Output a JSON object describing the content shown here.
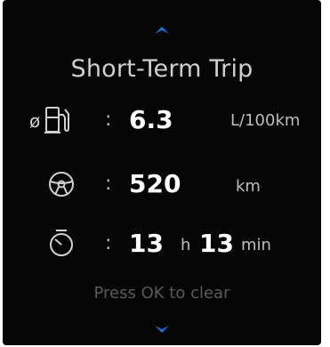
{
  "nav": {
    "up_icon": "chevron-up-icon",
    "down_icon": "chevron-down-icon",
    "accent": "#1e6fd9"
  },
  "title": "Short-Term Trip",
  "fuel": {
    "icon": "fuel-pump-icon",
    "prefix": "ø",
    "colon": ":",
    "value": "6.3",
    "unit": "L/100km"
  },
  "distance": {
    "icon": "steering-wheel-icon",
    "colon": ":",
    "value": "520",
    "unit": "km"
  },
  "time": {
    "icon": "stopwatch-icon",
    "colon": ":",
    "hours": "13",
    "hours_unit": "h",
    "minutes": "13",
    "minutes_unit": "min"
  },
  "hint": "Press OK to clear"
}
